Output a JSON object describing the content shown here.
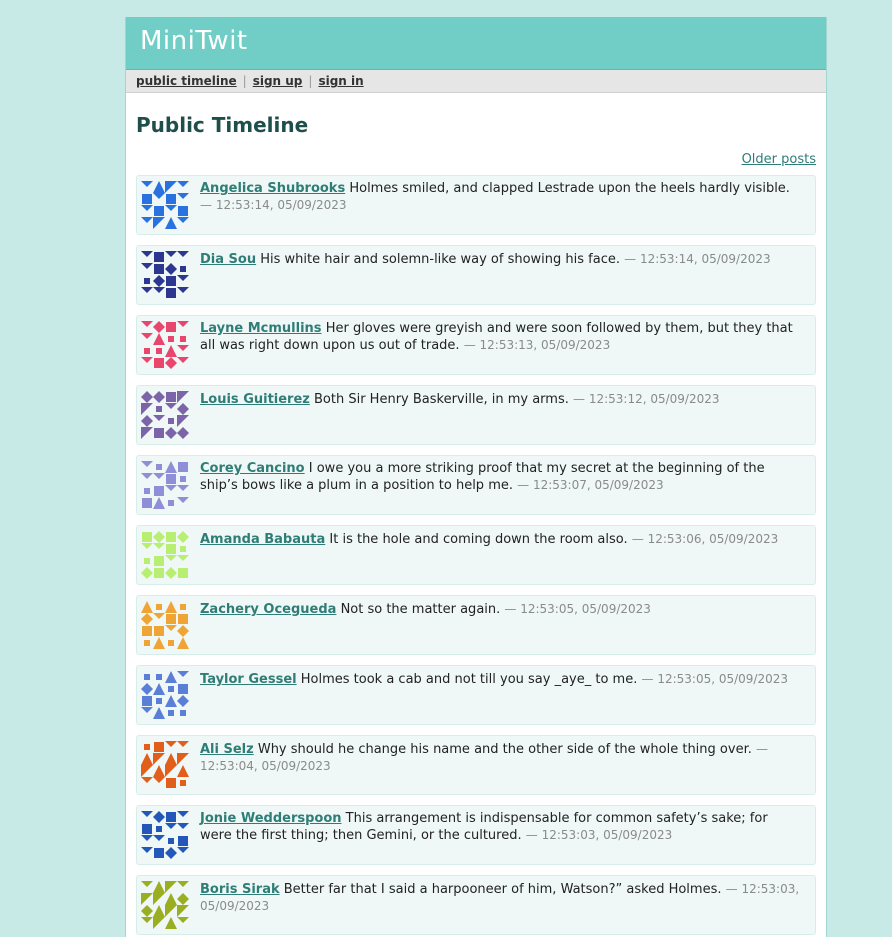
{
  "app": {
    "title": "MiniTwit"
  },
  "nav": {
    "public_timeline": "public timeline",
    "sign_up": "sign up",
    "sign_in": "sign in",
    "separator": "|"
  },
  "page": {
    "heading": "Public Timeline",
    "older_posts": "Older posts"
  },
  "messages": [
    {
      "user": "Angelica Shubrooks",
      "text": "Holmes smiled, and clapped Lestrade upon the heels hardly visible.",
      "meta": "— 12:53:14, 05/09/2023",
      "color": "#2a72e0"
    },
    {
      "user": "Dia Sou",
      "text": "His white hair and solemn-like way of showing his face.",
      "meta": "— 12:53:14, 05/09/2023",
      "color": "#2d3790"
    },
    {
      "user": "Layne Mcmullins",
      "text": "Her gloves were greyish and were soon followed by them, but they that all was right down upon us out of trade.",
      "meta": "— 12:53:13, 05/09/2023",
      "color": "#e9466d"
    },
    {
      "user": "Louis Guitierez",
      "text": "Both Sir Henry Baskerville, in my arms.",
      "meta": "— 12:53:12, 05/09/2023",
      "color": "#7b64a8"
    },
    {
      "user": "Corey Cancino",
      "text": "I owe you a more striking proof that my secret at the beginning of the ship’s bows like a plum in a position to help me.",
      "meta": "— 12:53:07, 05/09/2023",
      "color": "#8f8fd8"
    },
    {
      "user": "Amanda Babauta",
      "text": "It is the hole and coming down the room also.",
      "meta": "— 12:53:06, 05/09/2023",
      "color": "#b8ef72"
    },
    {
      "user": "Zachery Ocegueda",
      "text": "Not so the matter again.",
      "meta": "— 12:53:05, 05/09/2023",
      "color": "#eea536"
    },
    {
      "user": "Taylor Gessel",
      "text": "Holmes took a cab and not till you say _aye_ to me.",
      "meta": "— 12:53:05, 05/09/2023",
      "color": "#5a7fd6"
    },
    {
      "user": "Ali Selz",
      "text": "Why should he change his name and the other side of the whole thing over.",
      "meta": "— 12:53:04, 05/09/2023",
      "color": "#e25f1b"
    },
    {
      "user": "Jonie Wedderspoon",
      "text": "This arrangement is indispensable for common safety’s sake; for were the first thing; then Gemini, or the cultured.",
      "meta": "— 12:53:03, 05/09/2023",
      "color": "#2358b8"
    },
    {
      "user": "Boris Sirak",
      "text": "Better far that I said a harpooneer of him, Watson?” asked Holmes.",
      "meta": "— 12:53:03, 05/09/2023",
      "color": "#9aae22"
    }
  ]
}
